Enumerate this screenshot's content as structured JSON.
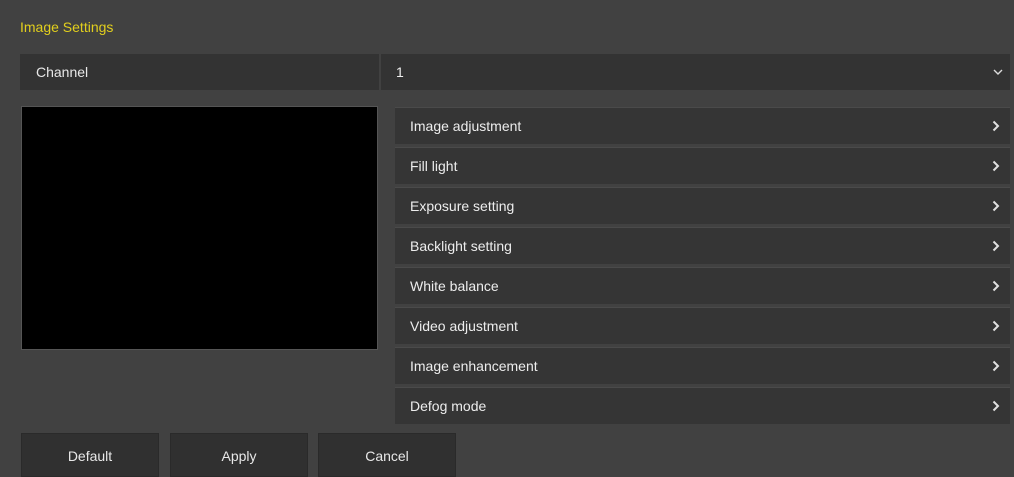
{
  "page": {
    "title": "Image Settings",
    "accent_color": "#e2cf1d"
  },
  "channel": {
    "label": "Channel",
    "value": "1",
    "icon": "chevron-down-icon"
  },
  "menu": {
    "items": [
      {
        "label": "Image adjustment",
        "icon": "chevron-right-icon"
      },
      {
        "label": "Fill light",
        "icon": "chevron-right-icon"
      },
      {
        "label": "Exposure setting",
        "icon": "chevron-right-icon"
      },
      {
        "label": "Backlight setting",
        "icon": "chevron-right-icon"
      },
      {
        "label": "White balance",
        "icon": "chevron-right-icon"
      },
      {
        "label": "Video adjustment",
        "icon": "chevron-right-icon"
      },
      {
        "label": "Image enhancement",
        "icon": "chevron-right-icon"
      },
      {
        "label": "Defog mode",
        "icon": "chevron-right-icon"
      }
    ]
  },
  "buttons": {
    "default_label": "Default",
    "apply_label": "Apply",
    "cancel_label": "Cancel"
  }
}
